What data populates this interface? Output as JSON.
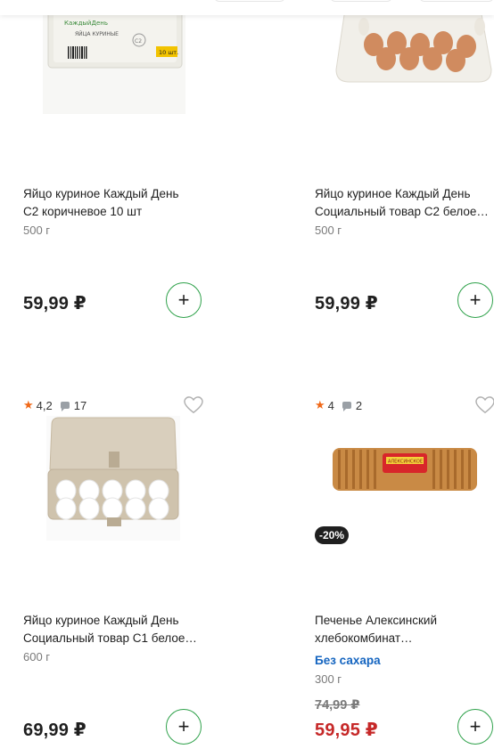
{
  "products": [
    {
      "title_line1": "Яйцо куриное Каждый День",
      "title_line2": "С2 коричневое 10 шт",
      "weight": "500 г",
      "price": "59,99 ₽",
      "package_label": "ЯЙЦА КУРИНЫЕ",
      "package_count": "10 шт.",
      "brand": "КаждыйДень",
      "grade": "С2"
    },
    {
      "title_line1": "Яйцо куриное Каждый День",
      "title_line2": "Социальный товар С2 белое…",
      "weight": "500 г",
      "price": "59,99 ₽"
    },
    {
      "rating": "4,2",
      "reviews": "17",
      "title_line1": "Яйцо куриное Каждый День",
      "title_line2": "Социальный товар С1 белое…",
      "weight": "600 г",
      "price": "69,99 ₽"
    },
    {
      "rating": "4",
      "reviews": "2",
      "badge": "-20%",
      "title_line1": "Печенье Алексинский",
      "title_line2": "хлебокомбинат…",
      "tag": "Без сахара",
      "weight": "300 г",
      "old_price": "74,99 ₽",
      "price": "59,95 ₽",
      "package_label": "АЛЕКСИНСКОЕ"
    }
  ],
  "add_label": "+",
  "colors": {
    "accent_green": "#2ea14a",
    "sale_red": "#c62828",
    "rating_orange": "#f06818",
    "tag_blue": "#1565c0"
  }
}
